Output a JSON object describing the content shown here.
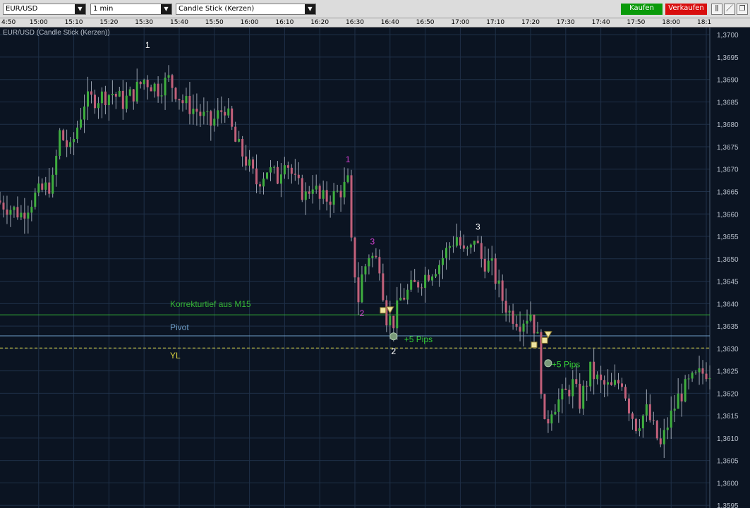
{
  "toolbar": {
    "symbol": "EUR/USD",
    "interval": "1 min",
    "chart_type": "Candle Stick (Kerzen)",
    "buy_label": "Kaufen",
    "sell_label": "Verkaufen",
    "buy_color": "#0a9a0a",
    "sell_color": "#d80e0e",
    "icons": [
      "bar-chart-icon",
      "draw-line-icon",
      "window-restore-icon"
    ]
  },
  "colors": {
    "background": "#0b1422",
    "grid": "#1f3048",
    "candle_up": "#3fae3f",
    "candle_down": "#c2607a",
    "wick": "#9aa3b0",
    "green_line": "#35b535",
    "pivot_line": "#6f9ec8",
    "yl_line": "#d8d040",
    "axis_text": "#b8c0cc"
  },
  "chart_data": {
    "type": "candlestick",
    "title": "EUR/USD (Candle Stick (Kerzen))",
    "x_ticks": [
      "4:50",
      "15:00",
      "15:10",
      "15:20",
      "15:30",
      "15:40",
      "15:50",
      "16:00",
      "16:10",
      "16:20",
      "16:30",
      "16:40",
      "16:50",
      "17:00",
      "17:10",
      "17:20",
      "17:30",
      "17:40",
      "17:50",
      "18:00",
      "18:1"
    ],
    "y_ticks": [
      "1,3595",
      "1,3600",
      "1,3605",
      "1,3610",
      "1,3615",
      "1,3620",
      "1,3625",
      "1,3630",
      "1,3635",
      "1,3640",
      "1,3645",
      "1,3650",
      "1,3655",
      "1,3660",
      "1,3665",
      "1,3670",
      "1,3675",
      "1,3680",
      "1,3685",
      "1,3690",
      "1,3695",
      "1,3700"
    ],
    "ylim": [
      1.35944,
      1.37016
    ],
    "x_range": [
      "14:49",
      "18:11"
    ],
    "grid": true,
    "ohlc_keyframes": [
      {
        "t": "14:49",
        "c": 1.3663
      },
      {
        "t": "14:56",
        "c": 1.366
      },
      {
        "t": "15:00",
        "c": 1.3664
      },
      {
        "t": "15:05",
        "c": 1.3667
      },
      {
        "t": "15:07",
        "c": 1.3678
      },
      {
        "t": "15:10",
        "c": 1.3674
      },
      {
        "t": "15:14",
        "c": 1.3685
      },
      {
        "t": "15:18",
        "c": 1.3686
      },
      {
        "t": "15:22",
        "c": 1.3687
      },
      {
        "t": "15:25",
        "c": 1.3685
      },
      {
        "t": "15:28",
        "c": 1.3687
      },
      {
        "t": "15:31",
        "c": 1.369
      },
      {
        "t": "15:35",
        "c": 1.3688
      },
      {
        "t": "15:38",
        "c": 1.369
      },
      {
        "t": "15:42",
        "c": 1.3685
      },
      {
        "t": "15:46",
        "c": 1.3683
      },
      {
        "t": "15:50",
        "c": 1.368
      },
      {
        "t": "15:54",
        "c": 1.3684
      },
      {
        "t": "15:57",
        "c": 1.3676
      },
      {
        "t": "16:00",
        "c": 1.3672
      },
      {
        "t": "16:03",
        "c": 1.3667
      },
      {
        "t": "16:06",
        "c": 1.367
      },
      {
        "t": "16:09",
        "c": 1.3668
      },
      {
        "t": "16:11",
        "c": 1.3673
      },
      {
        "t": "16:14",
        "c": 1.3667
      },
      {
        "t": "16:17",
        "c": 1.3664
      },
      {
        "t": "16:19",
        "c": 1.3667
      },
      {
        "t": "16:21",
        "c": 1.3663
      },
      {
        "t": "16:25",
        "c": 1.3664
      },
      {
        "t": "16:28",
        "c": 1.3666
      },
      {
        "t": "16:29",
        "c": 1.3667
      },
      {
        "t": "16:30",
        "c": 1.3653
      },
      {
        "t": "16:32",
        "c": 1.3641
      },
      {
        "t": "16:33",
        "c": 1.3646
      },
      {
        "t": "16:35",
        "c": 1.3651
      },
      {
        "t": "16:38",
        "c": 1.3649
      },
      {
        "t": "16:40",
        "c": 1.3637
      },
      {
        "t": "16:42",
        "c": 1.3636
      },
      {
        "t": "16:44",
        "c": 1.3641
      },
      {
        "t": "16:48",
        "c": 1.3644
      },
      {
        "t": "16:52",
        "c": 1.3647
      },
      {
        "t": "16:55",
        "c": 1.3649
      },
      {
        "t": "16:58",
        "c": 1.3653
      },
      {
        "t": "17:00",
        "c": 1.3655
      },
      {
        "t": "17:02",
        "c": 1.3651
      },
      {
        "t": "17:04",
        "c": 1.3652
      },
      {
        "t": "17:05",
        "c": 1.3655
      },
      {
        "t": "17:07",
        "c": 1.365
      },
      {
        "t": "17:10",
        "c": 1.3648
      },
      {
        "t": "17:13",
        "c": 1.3641
      },
      {
        "t": "17:15",
        "c": 1.3638
      },
      {
        "t": "17:18",
        "c": 1.3636
      },
      {
        "t": "17:21",
        "c": 1.3638
      },
      {
        "t": "17:23",
        "c": 1.3632
      },
      {
        "t": "17:24",
        "c": 1.3622
      },
      {
        "t": "17:25",
        "c": 1.3612
      },
      {
        "t": "17:27",
        "c": 1.3617
      },
      {
        "t": "17:30",
        "c": 1.3619
      },
      {
        "t": "17:33",
        "c": 1.3622
      },
      {
        "t": "17:35",
        "c": 1.3618
      },
      {
        "t": "17:38",
        "c": 1.3625
      },
      {
        "t": "17:41",
        "c": 1.3622
      },
      {
        "t": "17:44",
        "c": 1.3621
      },
      {
        "t": "17:47",
        "c": 1.3623
      },
      {
        "t": "17:49",
        "c": 1.3617
      },
      {
        "t": "17:51",
        "c": 1.3613
      },
      {
        "t": "17:54",
        "c": 1.3616
      },
      {
        "t": "17:57",
        "c": 1.361
      },
      {
        "t": "17:58",
        "c": 1.3608
      },
      {
        "t": "18:00",
        "c": 1.3613
      },
      {
        "t": "18:03",
        "c": 1.3619
      },
      {
        "t": "18:06",
        "c": 1.3622
      },
      {
        "t": "18:09",
        "c": 1.3624
      },
      {
        "t": "18:11",
        "c": 1.3625
      }
    ],
    "horizontal_lines": [
      {
        "label": "Korrekturtief aus M15",
        "y": 1.36375,
        "color": "#35b535",
        "style": "solid"
      },
      {
        "label": "Pivot",
        "y": 1.36328,
        "color": "#6f9ec8",
        "style": "solid"
      },
      {
        "label": "YL",
        "y": 1.36301,
        "color": "#d8d040",
        "style": "dashed"
      }
    ],
    "annotations": [
      {
        "text": "1",
        "t": "15:31",
        "y": 1.3697,
        "color": "#ffffff"
      },
      {
        "text": "1",
        "t": "16:28",
        "y": 1.36715,
        "color": "#d040d0"
      },
      {
        "text": "3",
        "t": "16:35",
        "y": 1.36532,
        "color": "#d040d0"
      },
      {
        "text": "2",
        "t": "16:32",
        "y": 1.36372,
        "color": "#d040d0"
      },
      {
        "text": "2",
        "t": "16:41",
        "y": 1.36287,
        "color": "#ffffff"
      },
      {
        "text": "3",
        "t": "17:05",
        "y": 1.36565,
        "color": "#ffffff"
      },
      {
        "text": "+5 Pips",
        "t": "16:44",
        "y": 1.36314,
        "color": "#35d035"
      },
      {
        "text": "+5 Pips",
        "t": "17:26",
        "y": 1.36258,
        "color": "#35d035"
      }
    ],
    "markers": [
      {
        "kind": "square",
        "t": "16:38",
        "y": 1.36385
      },
      {
        "kind": "triangle-down",
        "t": "16:40",
        "y": 1.36385
      },
      {
        "kind": "circle",
        "t": "16:41",
        "y": 1.36327
      },
      {
        "kind": "square",
        "t": "17:21",
        "y": 1.36308
      },
      {
        "kind": "square",
        "t": "17:24",
        "y": 1.36318
      },
      {
        "kind": "triangle-down",
        "t": "17:25",
        "y": 1.3633
      },
      {
        "kind": "circle",
        "t": "17:25",
        "y": 1.36267
      }
    ]
  }
}
